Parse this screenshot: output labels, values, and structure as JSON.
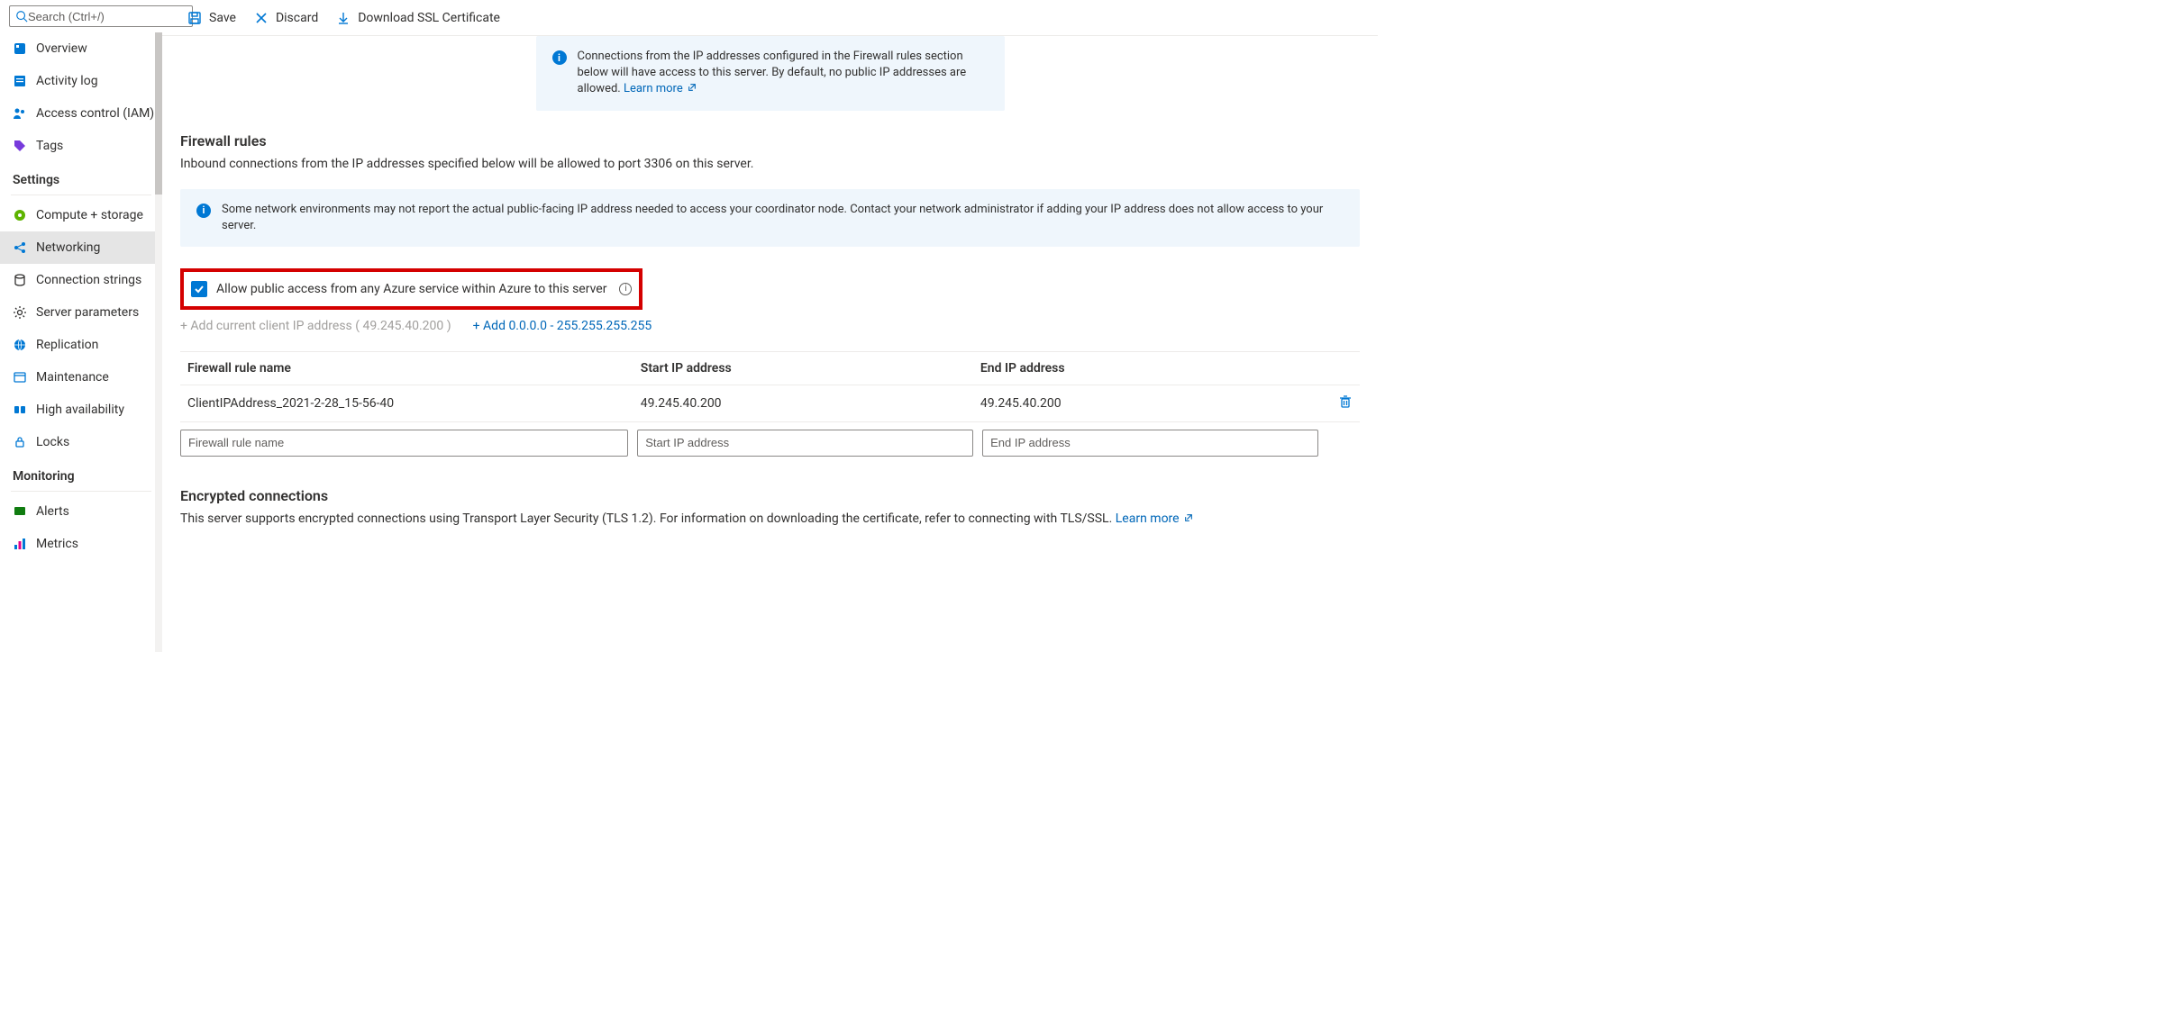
{
  "search": {
    "placeholder": "Search (Ctrl+/)"
  },
  "sidebar": {
    "top": [
      {
        "label": "Overview"
      },
      {
        "label": "Activity log"
      },
      {
        "label": "Access control (IAM)"
      },
      {
        "label": "Tags"
      }
    ],
    "settings_hdr": "Settings",
    "settings": [
      {
        "label": "Compute + storage"
      },
      {
        "label": "Networking"
      },
      {
        "label": "Connection strings"
      },
      {
        "label": "Server parameters"
      },
      {
        "label": "Replication"
      },
      {
        "label": "Maintenance"
      },
      {
        "label": "High availability"
      },
      {
        "label": "Locks"
      }
    ],
    "monitoring_hdr": "Monitoring",
    "monitoring": [
      {
        "label": "Alerts"
      },
      {
        "label": "Metrics"
      }
    ]
  },
  "toolbar": {
    "save": "Save",
    "discard": "Discard",
    "download": "Download SSL Certificate"
  },
  "info1": {
    "text": "Connections from the IP addresses configured in the Firewall rules section below will have access to this server. By default, no public IP addresses are allowed. ",
    "learn": "Learn more"
  },
  "firewall": {
    "title": "Firewall rules",
    "desc": "Inbound connections from the IP addresses specified below will be allowed to port 3306 on this server."
  },
  "info2": {
    "text": "Some network environments may not report the actual public-facing IP address needed to access your coordinator node. Contact your network administrator if adding your IP address does not allow access to your server."
  },
  "allow_azure": "Allow public access from any Azure service within Azure to this server",
  "add_current": "+ Add current client IP address ( 49.245.40.200 )",
  "add_range": "+ Add 0.0.0.0 - 255.255.255.255",
  "table": {
    "h1": "Firewall rule name",
    "h2": "Start IP address",
    "h3": "End IP address",
    "row": {
      "name": "ClientIPAddress_2021-2-28_15-56-40",
      "start": "49.245.40.200",
      "end": "49.245.40.200"
    },
    "ph1": "Firewall rule name",
    "ph2": "Start IP address",
    "ph3": "End IP address"
  },
  "enc": {
    "title": "Encrypted connections",
    "text": "This server supports encrypted connections using Transport Layer Security (TLS 1.2). For information on downloading the certificate, refer to connecting with TLS/SSL. ",
    "learn": "Learn more"
  }
}
